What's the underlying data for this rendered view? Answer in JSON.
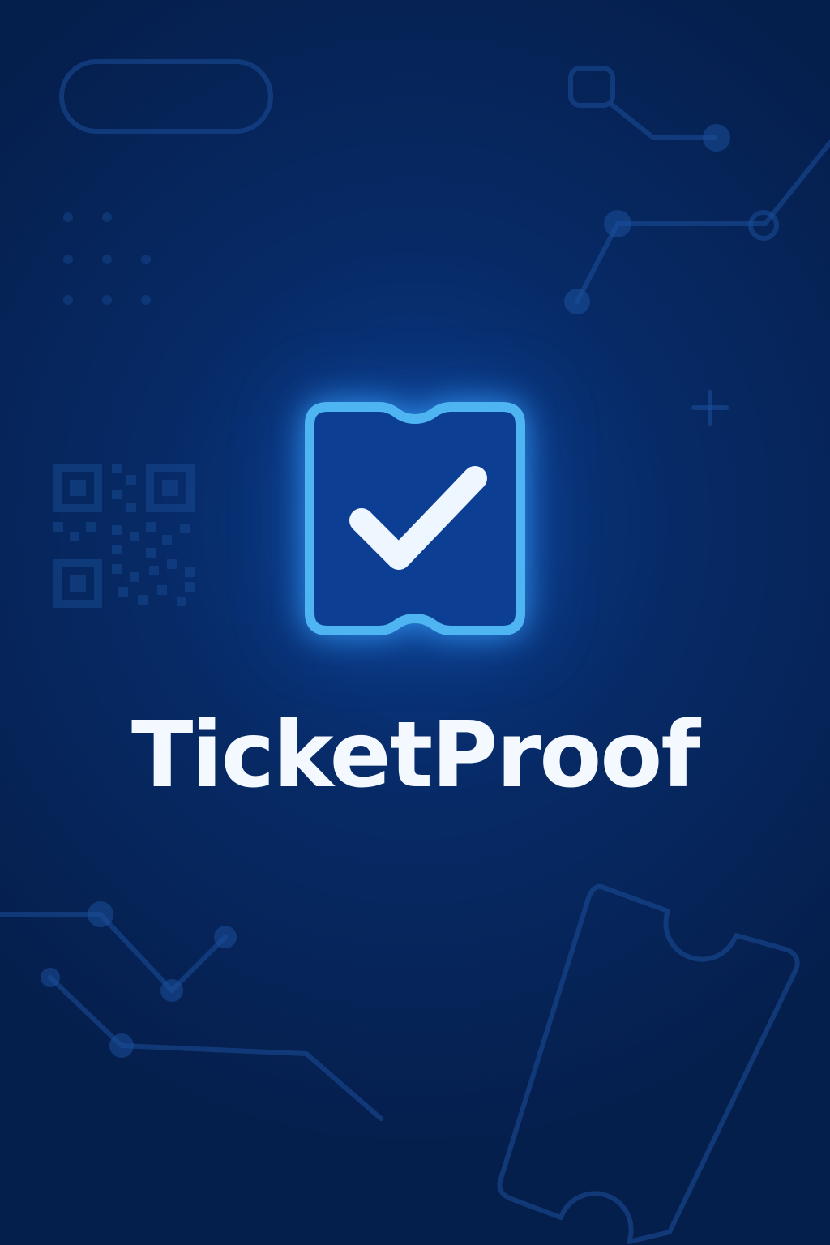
{
  "app": {
    "name": "TicketProof"
  },
  "logo": {
    "icon": "ticket-check-icon",
    "accent_color": "#4fb4f2",
    "check_color": "#eef6ff"
  },
  "background": {
    "colors": [
      "#0b3c8c",
      "#072a66",
      "#051f4d"
    ],
    "decorations": [
      "pill-shape",
      "network-nodes",
      "qr-code",
      "plus-sign",
      "ticket-outline"
    ]
  }
}
